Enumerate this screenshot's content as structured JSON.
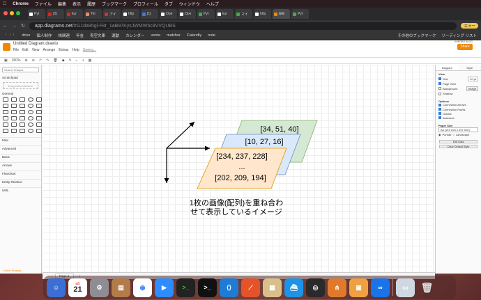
{
  "menubar": {
    "app": "Chrome",
    "items": [
      "ファイル",
      "編集",
      "表示",
      "履歴",
      "ブックマーク",
      "プロフィール",
      "タブ",
      "ウィンドウ",
      "ヘルプ"
    ],
    "datetime": "8月21日(土)  16:48:14"
  },
  "tabs": [
    {
      "label": "Pyt",
      "color": "#fff"
    },
    {
      "label": "(2)",
      "color": "#e62117"
    },
    {
      "label": "kur",
      "color": "#e62117"
    },
    {
      "label": "Tki",
      "color": "#e86"
    },
    {
      "label": "アイ",
      "color": "#c33"
    },
    {
      "label": "http",
      "color": "#fff"
    },
    {
      "label": "[1]",
      "color": "#3a7bd5"
    },
    {
      "label": "Ope",
      "color": "#fff"
    },
    {
      "label": "Ope",
      "color": "#fff"
    },
    {
      "label": "Pyt",
      "color": "#4a4"
    },
    {
      "label": "kur",
      "color": "#fff"
    },
    {
      "label": "マイ",
      "color": "#4a4"
    },
    {
      "label": "http",
      "color": "#fff"
    },
    {
      "label": "Unt",
      "color": "#f08705"
    },
    {
      "label": "Pyt",
      "color": "#4a4"
    }
  ],
  "address": {
    "host": "app.diagrams.net",
    "rest": "/#G1da95gl-F8r_1aB97KysJWMW5c9VVQUBS",
    "profile": "エラー"
  },
  "bookmarks": [
    "drive",
    "個人制作",
    "株関連",
    "年金",
    "青空文庫",
    "運動",
    "カレンダー",
    "venta",
    "matcher",
    "Calendly",
    "note"
  ],
  "bookmarks_right": [
    "その他のブックマーク",
    "リーディング リスト"
  ],
  "drawio": {
    "title": "Untitled Diagram.drawio",
    "menus": [
      "File",
      "Edit",
      "View",
      "Arrange",
      "Extras",
      "Help",
      "Saving..."
    ],
    "share": "Share",
    "zoom": "360%",
    "user": "KURORO BLOG",
    "search_placeholder": "Search Shapes",
    "scratchpad": "Scratchpad",
    "drag_here": "Drag elements here",
    "general": "General",
    "sections": [
      "Misc",
      "Advanced",
      "Basic",
      "Arrows",
      "Flowchart",
      "Entity Relation",
      "UML"
    ],
    "more_shapes": "+ More Shapes...",
    "page_tab": "Page-1",
    "right_tabs": [
      "Diagram",
      "Style"
    ],
    "view_title": "View",
    "grid": "Grid",
    "grid_size": "10 pt",
    "page_view": "Page View",
    "background": "Background",
    "image_btn": "Image",
    "shadow": "Shadow",
    "options_title": "Options",
    "options": [
      "Connection Arrows",
      "Connection Points",
      "Guides",
      "Autosave"
    ],
    "paper_title": "Paper Size",
    "paper_value": "A4 (210 mm x 297 mm)",
    "portrait": "Portrait",
    "landscape": "Landscape",
    "edit_data": "Edit Data",
    "clear_style": "Clear Default Style"
  },
  "diagram": {
    "layer_green": "[34, 51, 40]",
    "layer_blue": "[10, 27, 16]",
    "layer_orange_top": "[234, 237, 228]",
    "layer_orange_mid": "...",
    "layer_orange_bottom": "[202, 209, 194]",
    "caption_line1": "1枚の画像(配列)を重ね合わ",
    "caption_line2": "せて表示しているイメージ",
    "colors": {
      "green": "#d5e8d4",
      "green_stroke": "#82b366",
      "blue": "#dae8fc",
      "blue_stroke": "#6c8ebf",
      "orange": "#ffe6cc",
      "orange_stroke": "#d79b00"
    }
  },
  "dock": {
    "calendar_month": "8月",
    "calendar_day": "21"
  }
}
